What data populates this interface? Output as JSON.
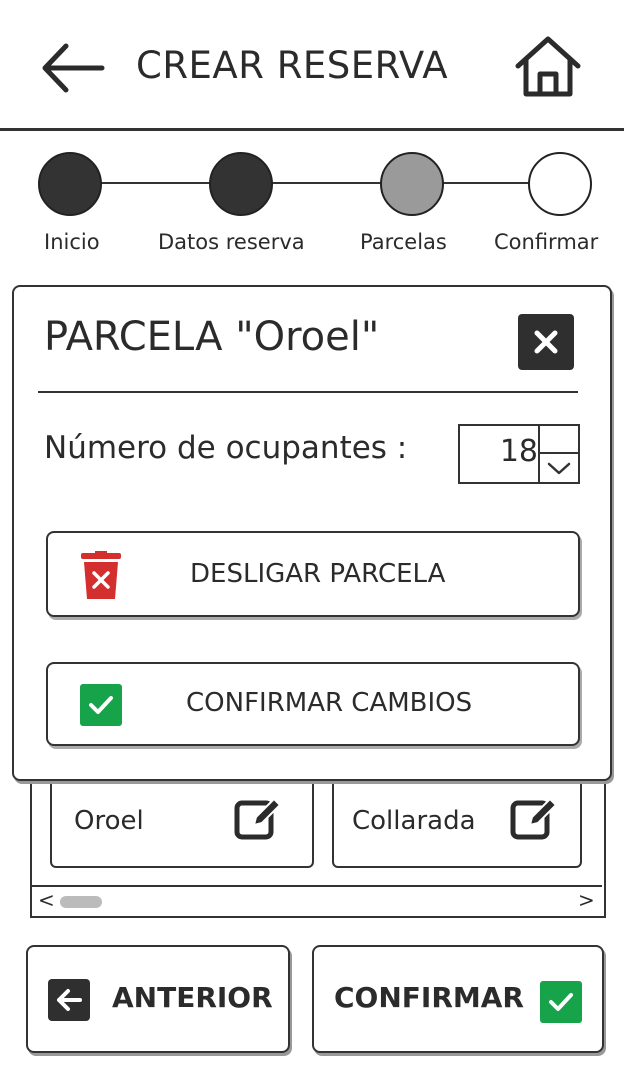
{
  "header": {
    "title": "CREAR RESERVA",
    "back_icon": "arrow-left-icon",
    "home_icon": "home-icon"
  },
  "stepper": {
    "steps": [
      {
        "label": "Inicio",
        "state": "done",
        "color": "#333333"
      },
      {
        "label": "Datos reserva",
        "state": "done",
        "color": "#333333"
      },
      {
        "label": "Parcelas",
        "state": "current",
        "color": "#9a9a9a"
      },
      {
        "label": "Confirmar",
        "state": "pending",
        "color": "#ffffff"
      }
    ]
  },
  "modal": {
    "title": "PARCELA \"Oroel\"",
    "close_icon": "close-icon",
    "occupants_label": "Número de ocupantes :",
    "occupants_value": "18",
    "unlink_button": {
      "label": "DESLIGAR PARCELA",
      "icon": "trash-icon",
      "icon_color": "#d32f2f"
    },
    "confirm_button": {
      "label": "CONFIRMAR CAMBIOS",
      "icon": "check-icon",
      "icon_color": "#16a34a"
    }
  },
  "parcels": {
    "items": [
      {
        "label": "Oroel",
        "icon": "edit-icon"
      },
      {
        "label": "Collarada",
        "icon": "edit-icon"
      }
    ],
    "scroll_left": "<",
    "scroll_right": ">"
  },
  "footer": {
    "previous_label": "ANTERIOR",
    "confirm_label": "CONFIRMAR",
    "confirm_color": "#16a34a"
  }
}
